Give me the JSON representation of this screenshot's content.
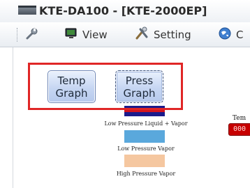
{
  "window": {
    "title": "KTE-DA100 - [KTE-2000EP]"
  },
  "menubar": {
    "items": [
      {
        "id": "tools",
        "label": "",
        "icon": "wrench-icon"
      },
      {
        "id": "view",
        "label": "View",
        "icon": "monitor-icon"
      },
      {
        "id": "setting",
        "label": "Setting",
        "icon": "tools-icon"
      },
      {
        "id": "communication",
        "label": "C",
        "icon": "globe-icon"
      }
    ]
  },
  "graph_buttons": {
    "temp": {
      "line1": "Temp",
      "line2": "Graph"
    },
    "press": {
      "line1": "Press",
      "line2": "Graph"
    }
  },
  "legend": [
    {
      "label": "Low Pressure Liquid + Vapor",
      "color": "#1b1b8c"
    },
    {
      "label": "Low Pressure Vapor",
      "color": "#5aa8dc"
    },
    {
      "label": "High Pressure Vapor",
      "color": "#f5c7a0"
    }
  ],
  "temp_widget": {
    "label": "Tem",
    "value": "000"
  },
  "colors": {
    "highlight": "#e02626",
    "temp_field": "#c70000",
    "press_bar_red": "#d4141e"
  }
}
